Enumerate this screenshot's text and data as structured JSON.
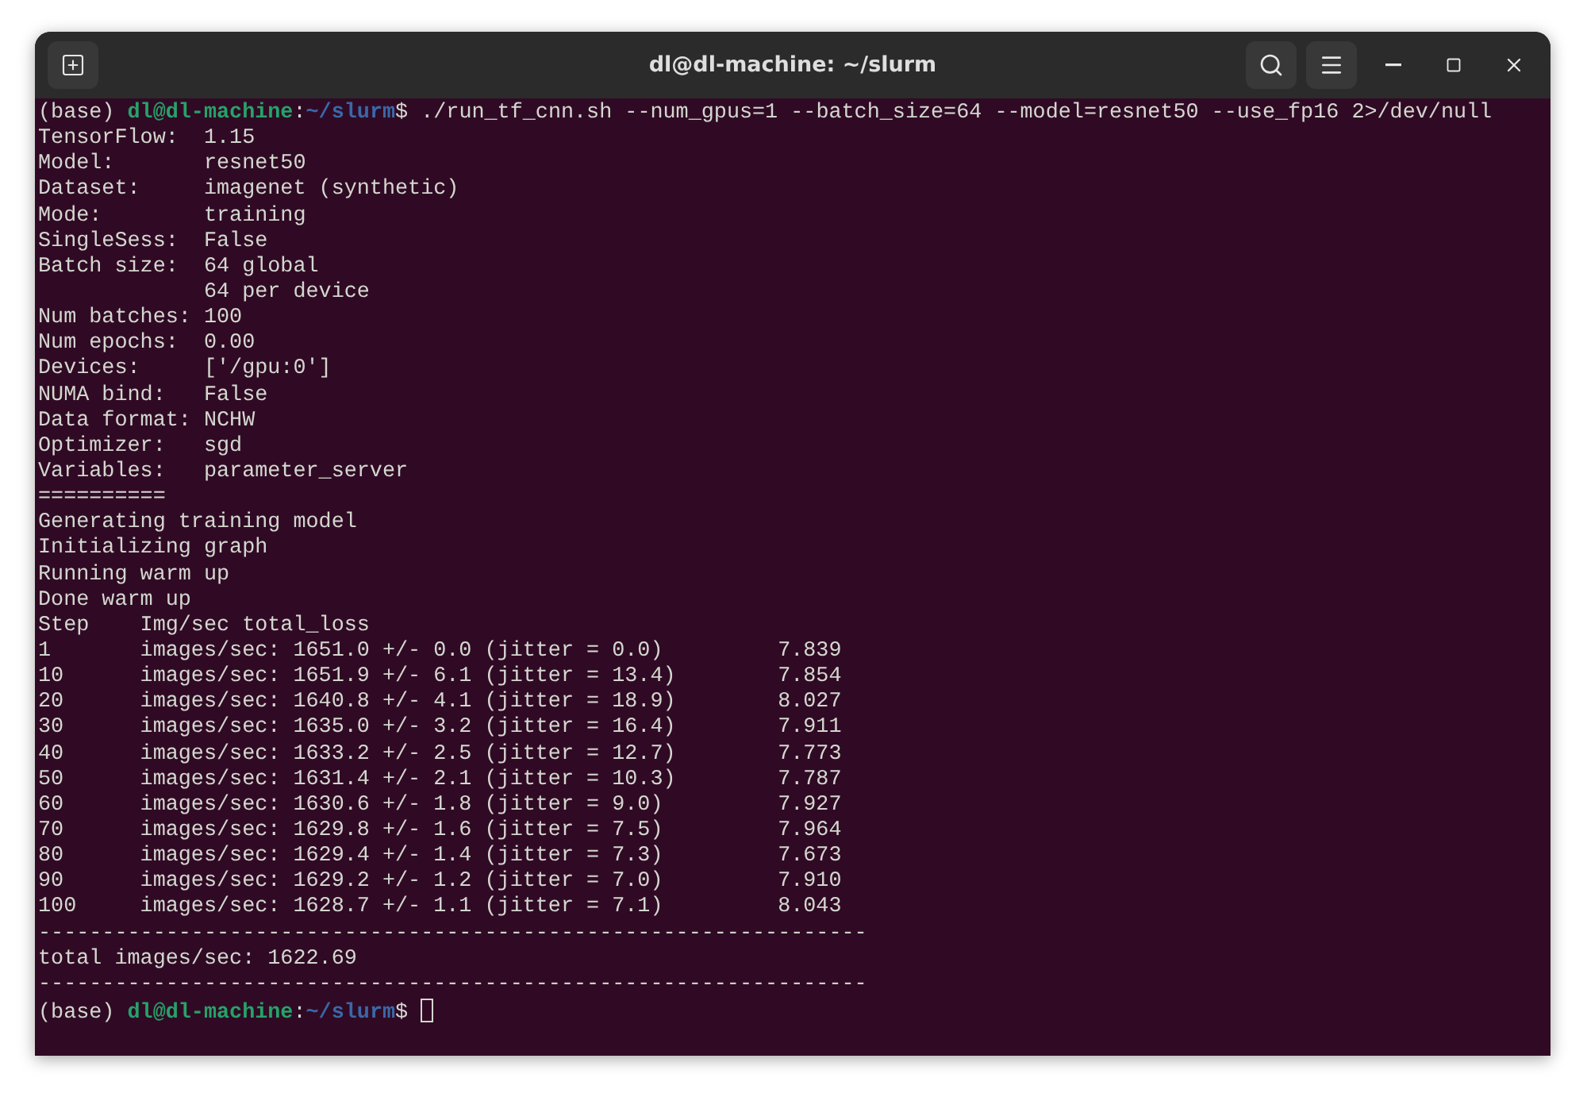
{
  "window": {
    "title": "dl@dl-machine: ~/slurm"
  },
  "terminal": {
    "lines": [
      {
        "kind": "prompt",
        "env": "(base) ",
        "user_host": "dl@dl-machine",
        "path": "~/slurm",
        "separator": ":",
        "symbol": "$",
        "command": " ./run_tf_cnn.sh --num_gpus=1 --batch_size=64 --model=resnet50 --use_fp16 2>/dev/null",
        "cursor": false
      },
      {
        "kind": "output",
        "text": "TensorFlow:  1.15"
      },
      {
        "kind": "output",
        "text": "Model:       resnet50"
      },
      {
        "kind": "output",
        "text": "Dataset:     imagenet (synthetic)"
      },
      {
        "kind": "output",
        "text": "Mode:        training"
      },
      {
        "kind": "output",
        "text": "SingleSess:  False"
      },
      {
        "kind": "output",
        "text": "Batch size:  64 global"
      },
      {
        "kind": "output",
        "text": "             64 per device"
      },
      {
        "kind": "output",
        "text": "Num batches: 100"
      },
      {
        "kind": "output",
        "text": "Num epochs:  0.00"
      },
      {
        "kind": "output",
        "text": "Devices:     ['/gpu:0']"
      },
      {
        "kind": "output",
        "text": "NUMA bind:   False"
      },
      {
        "kind": "output",
        "text": "Data format: NCHW"
      },
      {
        "kind": "output",
        "text": "Optimizer:   sgd"
      },
      {
        "kind": "output",
        "text": "Variables:   parameter_server"
      },
      {
        "kind": "output",
        "text": "=========="
      },
      {
        "kind": "output",
        "text": "Generating training model"
      },
      {
        "kind": "output",
        "text": "Initializing graph"
      },
      {
        "kind": "output",
        "text": "Running warm up"
      },
      {
        "kind": "output",
        "text": "Done warm up"
      },
      {
        "kind": "output",
        "text": "Step    Img/sec total_loss"
      },
      {
        "kind": "output",
        "text": "1       images/sec: 1651.0 +/- 0.0 (jitter = 0.0)         7.839"
      },
      {
        "kind": "output",
        "text": "10      images/sec: 1651.9 +/- 6.1 (jitter = 13.4)        7.854"
      },
      {
        "kind": "output",
        "text": "20      images/sec: 1640.8 +/- 4.1 (jitter = 18.9)        8.027"
      },
      {
        "kind": "output",
        "text": "30      images/sec: 1635.0 +/- 3.2 (jitter = 16.4)        7.911"
      },
      {
        "kind": "output",
        "text": "40      images/sec: 1633.2 +/- 2.5 (jitter = 12.7)        7.773"
      },
      {
        "kind": "output",
        "text": "50      images/sec: 1631.4 +/- 2.1 (jitter = 10.3)        7.787"
      },
      {
        "kind": "output",
        "text": "60      images/sec: 1630.6 +/- 1.8 (jitter = 9.0)         7.927"
      },
      {
        "kind": "output",
        "text": "70      images/sec: 1629.8 +/- 1.6 (jitter = 7.5)         7.964"
      },
      {
        "kind": "output",
        "text": "80      images/sec: 1629.4 +/- 1.4 (jitter = 7.3)         7.673"
      },
      {
        "kind": "output",
        "text": "90      images/sec: 1629.2 +/- 1.2 (jitter = 7.0)         7.910"
      },
      {
        "kind": "output",
        "text": "100     images/sec: 1628.7 +/- 1.1 (jitter = 7.1)         8.043"
      },
      {
        "kind": "output",
        "text": "-----------------------------------------------------------------"
      },
      {
        "kind": "output",
        "text": "total images/sec: 1622.69"
      },
      {
        "kind": "output",
        "text": "-----------------------------------------------------------------"
      },
      {
        "kind": "prompt",
        "env": "(base) ",
        "user_host": "dl@dl-machine",
        "path": "~/slurm",
        "separator": ":",
        "symbol": "$",
        "cursor": true
      }
    ]
  }
}
